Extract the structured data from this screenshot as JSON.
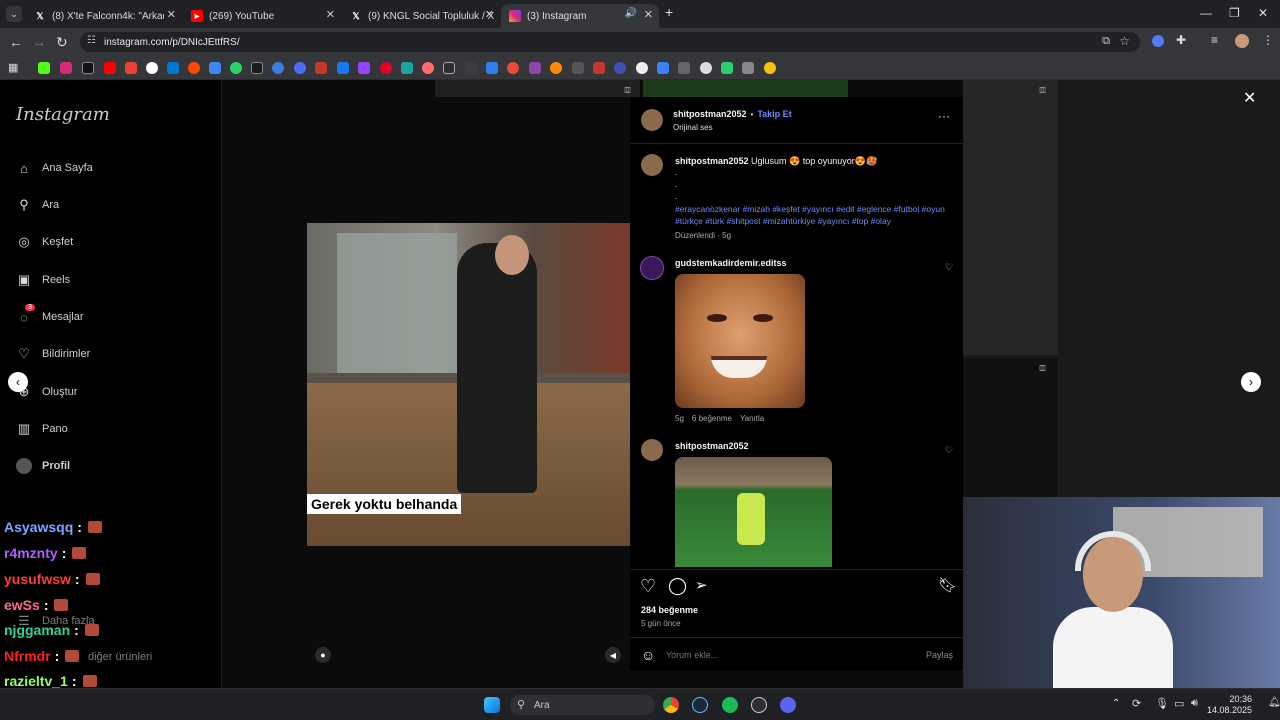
{
  "browser": {
    "tabs": [
      {
        "title": "(8) X'te Falconn4k: \"Arkadaşlar",
        "icon": "x-icon"
      },
      {
        "title": "(269) YouTube",
        "icon": "youtube-icon"
      },
      {
        "title": "(9) KNGL Social Topluluk / X",
        "icon": "x-icon"
      },
      {
        "title": "(3) Instagram",
        "icon": "instagram-icon"
      }
    ],
    "url": "instagram.com/p/DNIcJEttfRS/"
  },
  "sidebar": {
    "logo": "Instagram",
    "items": [
      {
        "label": "Ana Sayfa",
        "icon": "home-icon"
      },
      {
        "label": "Ara",
        "icon": "search-icon"
      },
      {
        "label": "Keşfet",
        "icon": "compass-icon"
      },
      {
        "label": "Reels",
        "icon": "reels-icon"
      },
      {
        "label": "Mesajlar",
        "icon": "messenger-icon",
        "badge": "3"
      },
      {
        "label": "Bildirimler",
        "icon": "heart-icon"
      },
      {
        "label": "Oluştur",
        "icon": "plus-icon"
      },
      {
        "label": "Pano",
        "icon": "dashboard-icon"
      },
      {
        "label": "Profil",
        "icon": "avatar-icon"
      }
    ],
    "more": "Daha fazla",
    "other_products": "diğer ürünleri"
  },
  "video": {
    "overlay_caption": "Gerek yoktu belhanda"
  },
  "post": {
    "author": "shitpostman2052",
    "follow": "Takip Et",
    "separator": "•",
    "audio": "Orijinal ses",
    "caption_text": "Uglusum 😍 top oyunuyor😍🥵",
    "dots": ".",
    "hashtags": "#eraycanözkenar #mizah #keşfet #yayıncı #edit #eglence #futbol #oyun #türkçe #türk #shitpost #mizahtürkiye #yayıncı #top #olay",
    "edited": "Düzenlendi · 5g",
    "comments": [
      {
        "user": "gudstemkadirdemir.editss",
        "meta_time": "5g",
        "meta_likes": "6 beğenme",
        "meta_reply": "Yanıtla"
      },
      {
        "user": "shitpostman2052"
      }
    ],
    "likes": "284 beğenme",
    "time_ago": "5 gün önce",
    "comment_placeholder": "Yorum ekle...",
    "share": "Paylaş"
  },
  "chat": [
    {
      "user": "Asyawsqq",
      "color": "#7aa7ff"
    },
    {
      "user": "r4mznty",
      "color": "#b05cff"
    },
    {
      "user": "yusufwsw",
      "color": "#ff3b3b"
    },
    {
      "user": "ewSs",
      "color": "#ff6a8a"
    },
    {
      "user": "njggaman",
      "color": "#35d0a0"
    },
    {
      "user": "Nfrmdr",
      "color": "#ff2020"
    },
    {
      "user": "razieltv_1",
      "color": "#9dff5a"
    }
  ],
  "chat_sep": ":",
  "taskbar": {
    "search": "Ara",
    "time": "20:36",
    "date": "14.08.2025"
  },
  "colors": {
    "accent_link": "#6f8cff",
    "background": "#000000"
  }
}
